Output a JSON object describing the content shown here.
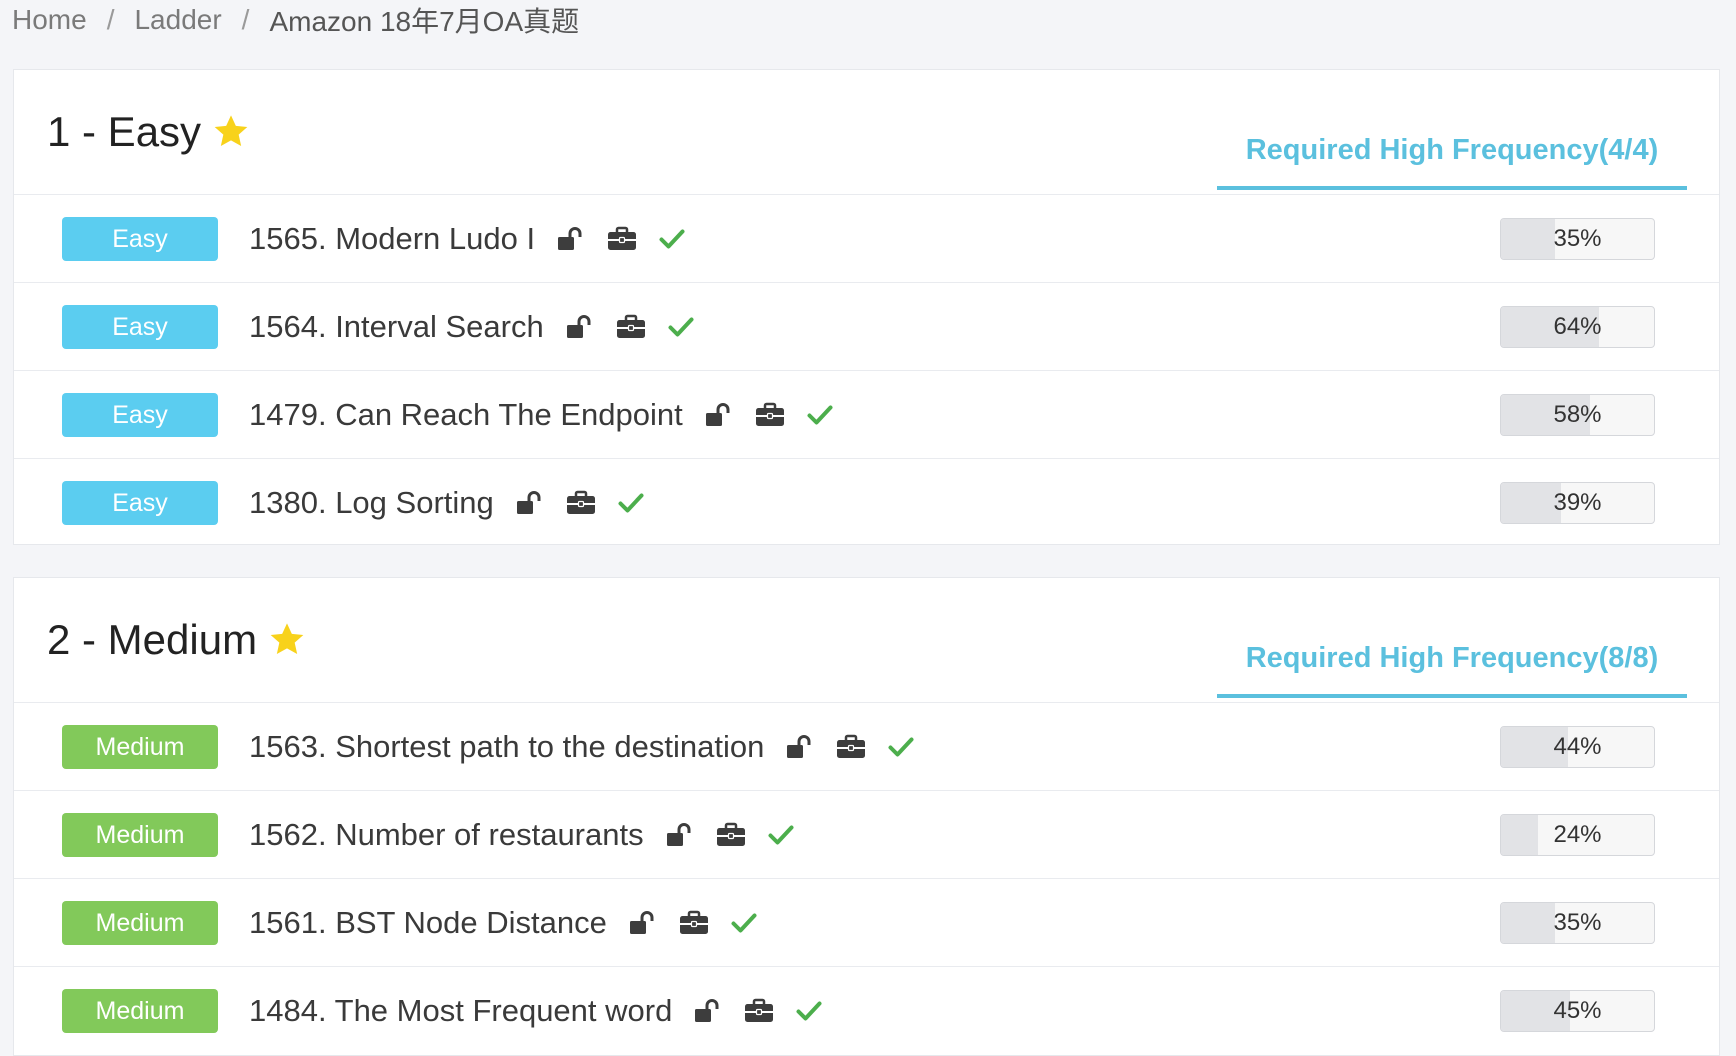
{
  "breadcrumb": [
    {
      "label": "Home"
    },
    {
      "label": "Ladder"
    },
    {
      "label": "Amazon 18年7月OA真题"
    }
  ],
  "colors": {
    "easy_badge": "#5bcdf0",
    "medium_badge": "#82c95a",
    "accent": "#5bc0de",
    "check": "#4cae4c",
    "star": "#f8d21b"
  },
  "sections": [
    {
      "title": "1 - Easy",
      "tab_label": "Required High Frequency(4/4)",
      "problems": [
        {
          "difficulty": "Easy",
          "title": "1565. Modern Ludo I",
          "rate": "35%",
          "rate_value": 35
        },
        {
          "difficulty": "Easy",
          "title": "1564. Interval Search",
          "rate": "64%",
          "rate_value": 64
        },
        {
          "difficulty": "Easy",
          "title": "1479. Can Reach The Endpoint",
          "rate": "58%",
          "rate_value": 58
        },
        {
          "difficulty": "Easy",
          "title": "1380. Log Sorting",
          "rate": "39%",
          "rate_value": 39
        }
      ]
    },
    {
      "title": "2 - Medium",
      "tab_label": "Required High Frequency(8/8)",
      "problems": [
        {
          "difficulty": "Medium",
          "title": "1563. Shortest path to the destination",
          "rate": "44%",
          "rate_value": 44
        },
        {
          "difficulty": "Medium",
          "title": "1562. Number of restaurants",
          "rate": "24%",
          "rate_value": 24
        },
        {
          "difficulty": "Medium",
          "title": "1561. BST Node Distance",
          "rate": "35%",
          "rate_value": 35
        },
        {
          "difficulty": "Medium",
          "title": "1484. The Most Frequent word",
          "rate": "45%",
          "rate_value": 45
        }
      ]
    }
  ],
  "icons": {
    "lock": "unlock-icon",
    "company": "briefcase-icon",
    "status": "check-icon",
    "star": "star-icon"
  }
}
